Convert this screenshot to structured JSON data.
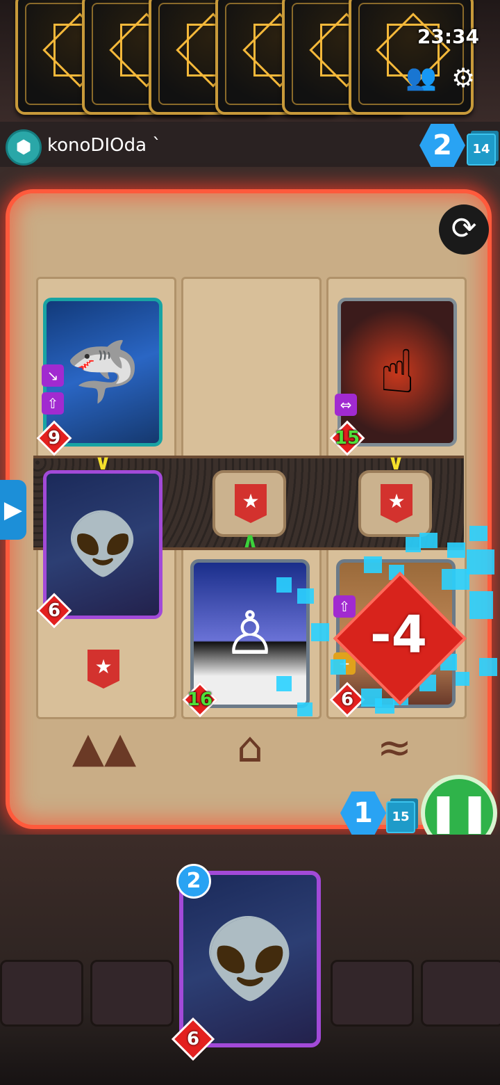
{
  "status_bar": {
    "time": "23:34"
  },
  "top_bar": {
    "friends_icon": "friends-icon",
    "settings_icon": "gear-icon"
  },
  "opponent": {
    "name": "konoDIOda",
    "energy": "2",
    "deck_count": "14",
    "hand_cards": 6
  },
  "board": {
    "lanes": [
      {
        "icon": "mountain-icon",
        "opponent_card": {
          "name": "shark",
          "power": "9"
        },
        "player_card": {
          "name": "antenna-bruiser",
          "power": "6"
        }
      },
      {
        "icon": "house-icon",
        "opponent_card": null,
        "player_card": {
          "name": "chess-pawn",
          "power": "16"
        }
      },
      {
        "icon": "waves-icon",
        "opponent_card": {
          "name": "golden-finger",
          "power": "15"
        },
        "player_card": {
          "name": "boxer",
          "power": "6"
        }
      }
    ],
    "damage_popup": "-4"
  },
  "player": {
    "energy": "1",
    "deck_count": "15",
    "hand": [
      {
        "cost": "2",
        "power": "6"
      }
    ]
  },
  "colors": {
    "arena_glow": "#ff5a3c",
    "energy_blue": "#29a3f3",
    "end_turn_green": "#2fb34a",
    "power_red": "#e3201f"
  }
}
